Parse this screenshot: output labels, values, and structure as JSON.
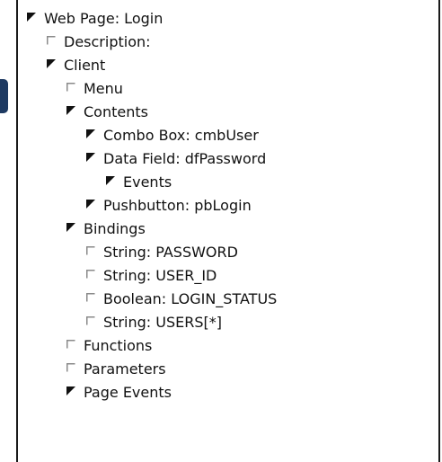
{
  "tree": {
    "nodes": [
      {
        "label": "Web Page: Login",
        "level": 0,
        "state": "expanded"
      },
      {
        "label": "Description:",
        "level": 1,
        "state": "collapsed"
      },
      {
        "label": "Client",
        "level": 1,
        "state": "expanded"
      },
      {
        "label": "Menu",
        "level": 2,
        "state": "collapsed"
      },
      {
        "label": "Contents",
        "level": 2,
        "state": "expanded"
      },
      {
        "label": "Combo Box: cmbUser",
        "level": 3,
        "state": "expanded"
      },
      {
        "label": "Data Field: dfPassword",
        "level": 3,
        "state": "expanded"
      },
      {
        "label": "Events",
        "level": 4,
        "state": "expanded"
      },
      {
        "label": "Pushbutton: pbLogin",
        "level": 3,
        "state": "expanded"
      },
      {
        "label": "Bindings",
        "level": 2,
        "state": "expanded"
      },
      {
        "label": "String: PASSWORD",
        "level": 3,
        "state": "collapsed"
      },
      {
        "label": "String: USER_ID",
        "level": 3,
        "state": "collapsed"
      },
      {
        "label": "Boolean: LOGIN_STATUS",
        "level": 3,
        "state": "collapsed"
      },
      {
        "label": "String: USERS[*]",
        "level": 3,
        "state": "collapsed"
      },
      {
        "label": "Functions",
        "level": 2,
        "state": "collapsed"
      },
      {
        "label": "Parameters",
        "level": 2,
        "state": "collapsed"
      },
      {
        "label": "Page Events",
        "level": 2,
        "state": "expanded"
      }
    ]
  },
  "colors": {
    "text": "#111111",
    "panel_border": "#1a1a1a",
    "expanded_glyph": "#111111",
    "collapsed_glyph": "#8a8a8a",
    "left_fragment": "#1e3a62"
  }
}
